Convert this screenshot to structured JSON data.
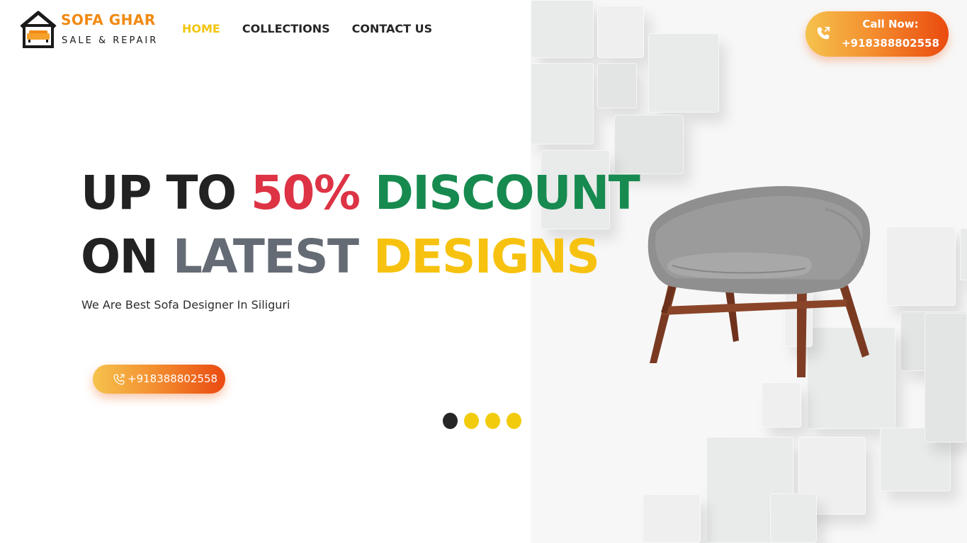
{
  "brand": {
    "title": "SOFA GHAR",
    "subtitle": "SALE & REPAIR",
    "accent": "#f08a12"
  },
  "nav": {
    "items": [
      {
        "label": "HOME",
        "active": true
      },
      {
        "label": "COLLECTIONS",
        "active": false
      },
      {
        "label": "CONTACT US",
        "active": false
      }
    ],
    "active_color": "#f2c50f"
  },
  "call_now": {
    "label": "Call Now:",
    "number": "+918388802558",
    "icon": "phone-call-icon"
  },
  "hero": {
    "line1": {
      "a": "UP TO ",
      "b": "50%",
      "c": " DISCOUNT"
    },
    "line2": {
      "a": "ON ",
      "b": "LATEST",
      "c": " DESIGNS"
    },
    "tagline": "We Are Best Sofa Designer In Siliguri",
    "button_label": "+918388802558",
    "colors": {
      "red": "#dd3345",
      "green": "#178a4f",
      "grey": "#656b74",
      "yellow": "#f7c20f"
    }
  },
  "slider": {
    "total": 4,
    "active_index": 0
  },
  "image": {
    "subject": "chair-icon"
  }
}
